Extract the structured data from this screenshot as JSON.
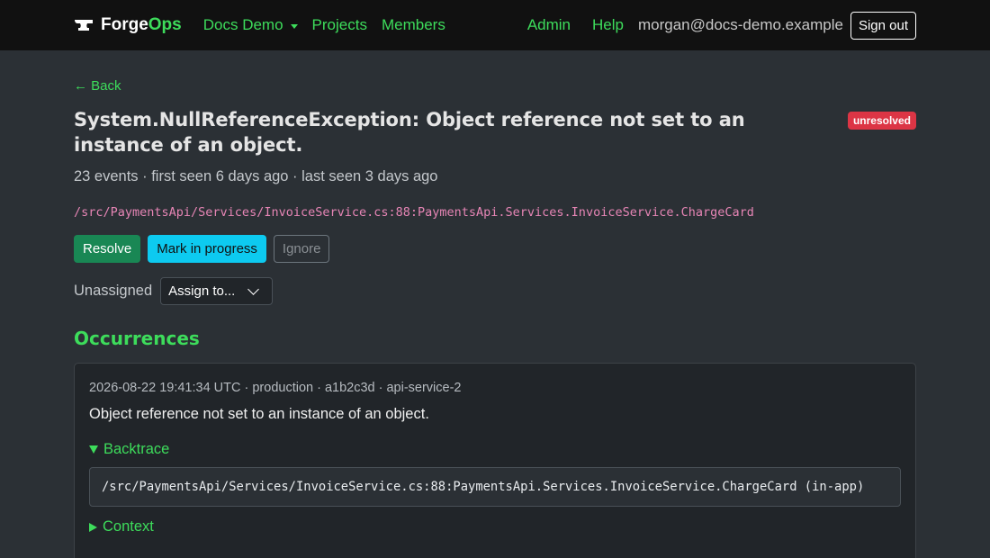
{
  "navbar": {
    "brand_prefix": "Forge",
    "brand_suffix": "Ops",
    "org_dropdown_label": "Docs Demo",
    "projects_label": "Projects",
    "members_label": "Members",
    "admin_label": "Admin",
    "help_label": "Help",
    "user_email": "morgan@docs-demo.example",
    "signout_label": "Sign out"
  },
  "issue": {
    "back_label": "← Back",
    "title": "System.NullReferenceException: Object reference not set to an instance of an object.",
    "status_badge": "unresolved",
    "meta": "23 events · first seen 6 days ago · last seen 3 days ago",
    "culprit": "/src/PaymentsApi/Services/InvoiceService.cs:88:PaymentsApi.Services.InvoiceService.ChargeCard",
    "actions": {
      "resolve_label": "Resolve",
      "in_progress_label": "Mark in progress",
      "ignore_label": "Ignore"
    },
    "assignee_label": "Unassigned",
    "assign_select_value": "Assign to..."
  },
  "occurrences": {
    "title": "Occurrences",
    "items": [
      {
        "meta": "2026-08-22 19:41:34 UTC · production · a1b2c3d · api-service-2",
        "message": "Object reference not set to an instance of an object.",
        "backtrace_label": "Backtrace",
        "backtrace_line": "/src/PaymentsApi/Services/InvoiceService.cs:88:PaymentsApi.Services.InvoiceService.ChargeCard (in-app)",
        "context_label": "Context"
      }
    ]
  },
  "colors": {
    "accent_green": "#3ddc5b",
    "navbar_bg": "#111111",
    "page_bg": "#2b3035",
    "badge_red": "#dc3545",
    "resolve_green": "#198754",
    "progress_cyan": "#0dcaf0",
    "culprit_pink": "#e685b5"
  }
}
